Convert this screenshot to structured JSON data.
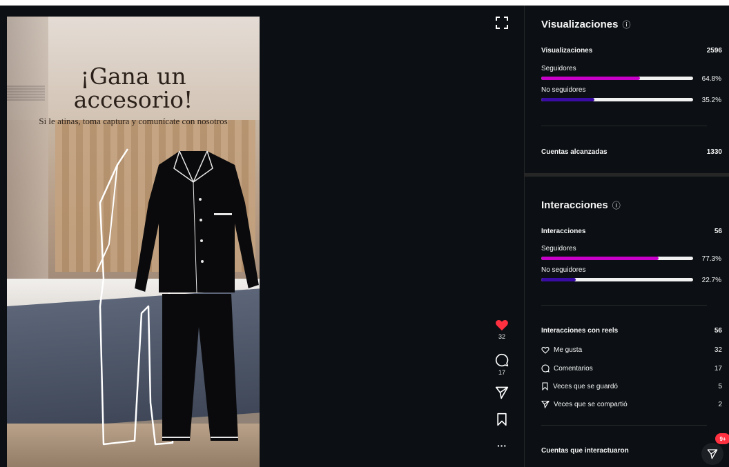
{
  "reel": {
    "title": "¡Gana un accesorio!",
    "subtitle": "Si le atinas, toma captura y comunícate con nosotros"
  },
  "actions": {
    "likes": "32",
    "comments": "17",
    "more": "···"
  },
  "views_section": {
    "title": "Visualizaciones",
    "total_label": "Visualizaciones",
    "total_value": "2596",
    "followers_label": "Seguidores",
    "followers_pct": "64.8%",
    "followers_fraction": 0.648,
    "non_followers_label": "No seguidores",
    "non_followers_pct": "35.2%",
    "non_followers_fraction": 0.352,
    "reached_label": "Cuentas alcanzadas",
    "reached_value": "1330"
  },
  "interactions_section": {
    "title": "Interacciones",
    "total_label": "Interacciones",
    "total_value": "56",
    "followers_label": "Seguidores",
    "followers_pct": "77.3%",
    "followers_fraction": 0.773,
    "non_followers_label": "No seguidores",
    "non_followers_pct": "22.7%",
    "non_followers_fraction": 0.227,
    "reel_interactions_label": "Interacciones con reels",
    "reel_interactions_value": "56",
    "metrics": [
      {
        "icon": "heart-outline-icon",
        "label": "Me gusta",
        "value": "32"
      },
      {
        "icon": "comment-icon",
        "label": "Comentarios",
        "value": "17"
      },
      {
        "icon": "bookmark-icon",
        "label": "Veces que se guardó",
        "value": "5"
      },
      {
        "icon": "share-icon",
        "label": "Veces que se compartió",
        "value": "2"
      }
    ],
    "interacting_accounts_label": "Cuentas que interactuaron"
  },
  "share_badge": "9+",
  "colors": {
    "background": "#0c1014",
    "followers_bar": "#c800c8",
    "non_followers_bar": "#3a0ca3",
    "like_red": "#ff3040"
  }
}
